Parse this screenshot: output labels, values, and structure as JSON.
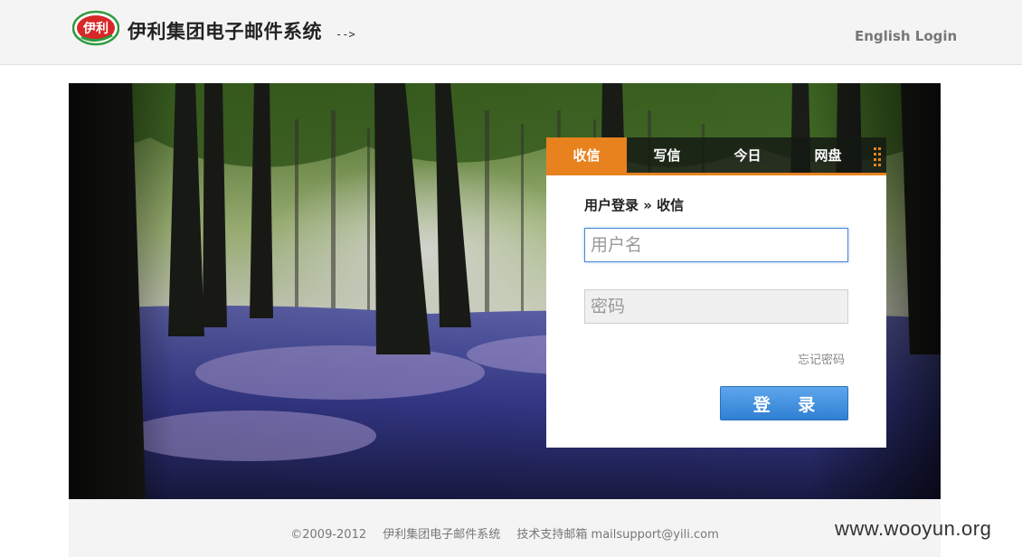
{
  "header": {
    "logo_text": "伊利",
    "site_title": "伊利集团电子邮件系统",
    "arrow_text": "-->",
    "english_login": "English Login"
  },
  "tabs": [
    {
      "label": "收信",
      "active": true
    },
    {
      "label": "写信",
      "active": false
    },
    {
      "label": "今日",
      "active": false
    },
    {
      "label": "网盘",
      "active": false
    }
  ],
  "form": {
    "title": "用户登录 » 收信",
    "username_placeholder": "用户名",
    "password_placeholder": "密码",
    "forgot_password": "忘记密码",
    "login_button": "登 录"
  },
  "footer": {
    "copyright": "©2009-2012",
    "system_name": "伊利集团电子邮件系统",
    "support": "技术支持邮箱 mailsupport@yili.com"
  },
  "watermark": "www.wooyun.org",
  "colors": {
    "accent": "#e8821e",
    "button": "#3a88d8",
    "focus_border": "#4a8ad6"
  },
  "icons": {
    "logo": "yili-logo-icon",
    "grip": "grip-dots-icon"
  }
}
